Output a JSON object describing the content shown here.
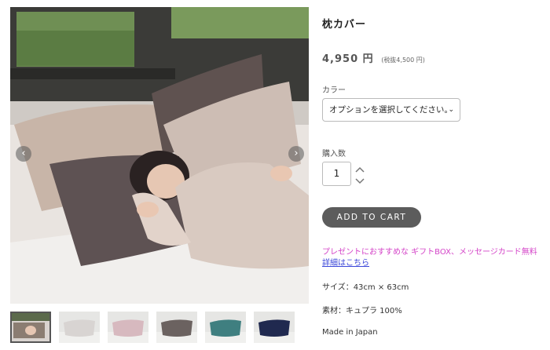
{
  "product": {
    "title": "枕カバー",
    "price": "4,950 円",
    "price_tax_note": "(税抜4,500 円)"
  },
  "options": {
    "color_label": "カラー",
    "color_select_value": "オプションを選択してください。",
    "quantity_label": "購入数",
    "quantity_value": "1"
  },
  "cart": {
    "button_label": "ADD TO CART"
  },
  "promo": {
    "text": "プレゼントにおすすめな ギフトBOX、メッセージカード無料",
    "link_text": "詳細はこちら"
  },
  "specs": {
    "size": "サイズ：43cm × 63cm",
    "material": "素材：キュプラ 100%",
    "origin": "Made in Japan"
  },
  "gallery": {
    "prev_icon": "‹",
    "next_icon": "›",
    "thumbnail_colors": [
      "#8b7d72",
      "#d8d4d2",
      "#d7b9bf",
      "#6b6260",
      "#3f7f80",
      "#20294f"
    ],
    "selected_thumbnail": 0
  },
  "colors": {
    "button_bg": "#5c5c5c",
    "promo_text": "#d444c8",
    "link_text": "#3a46d9"
  }
}
